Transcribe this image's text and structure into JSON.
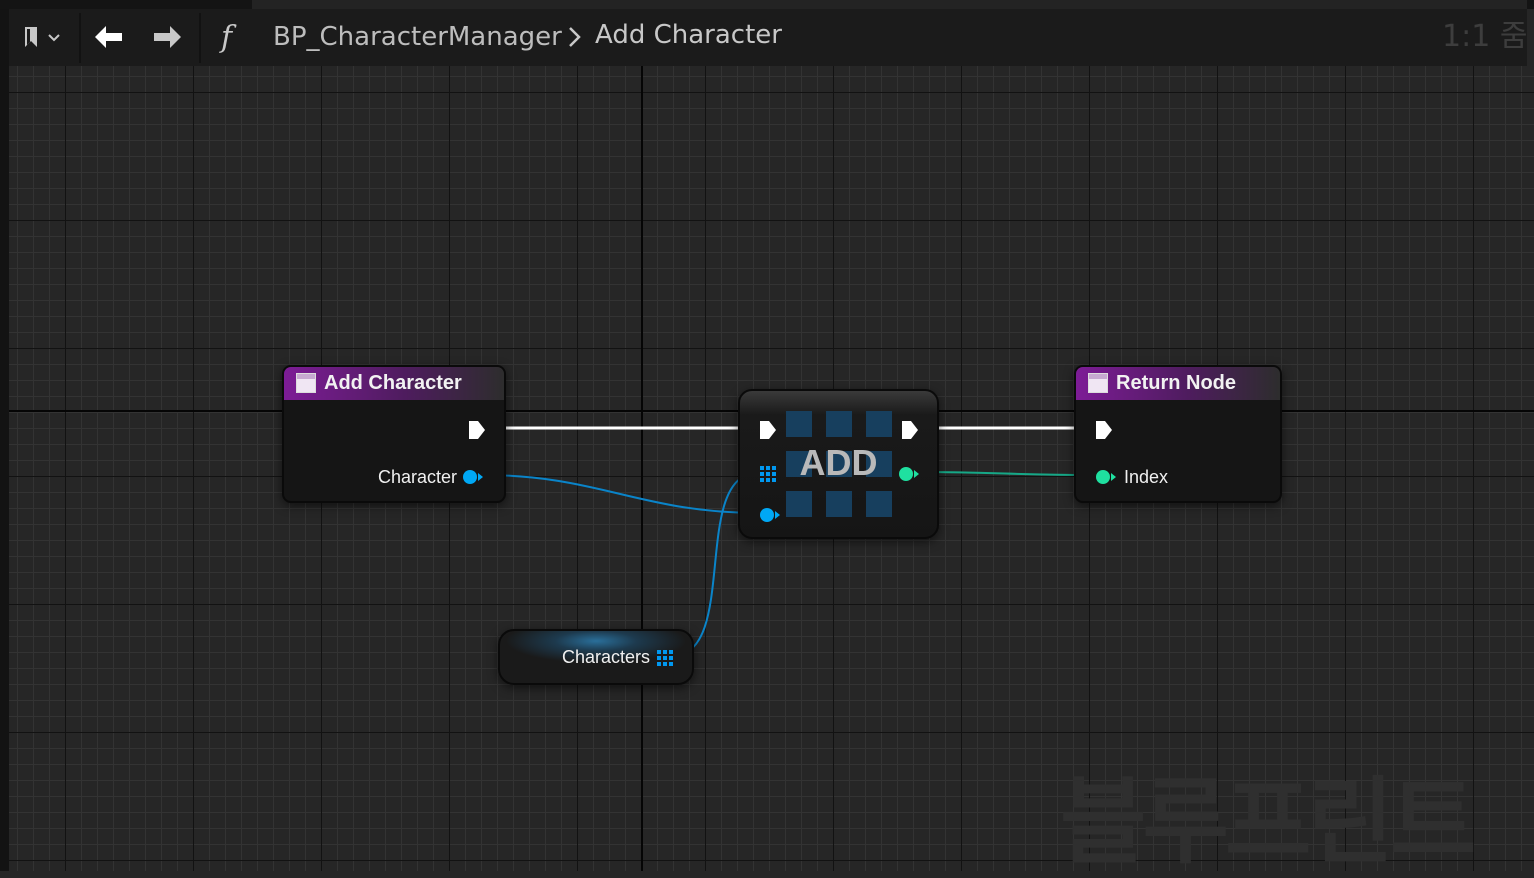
{
  "toolbar": {
    "bookmark_icon": "bookmark-icon",
    "back_icon": "arrow-left-icon",
    "forward_icon": "arrow-right-icon",
    "function_icon": "f",
    "breadcrumb": {
      "parent": "BP_CharacterManager",
      "current": "Add Character"
    },
    "zoom": "1:1 줌"
  },
  "graph": {
    "nodes": {
      "entry": {
        "title": "Add Character",
        "output_pin": "Character"
      },
      "add": {
        "title": "ADD"
      },
      "return": {
        "title": "Return Node",
        "input_pin": "Index"
      },
      "variable": {
        "label": "Characters"
      }
    },
    "watermark": "블루프린트"
  },
  "colors": {
    "function_header": "#7d1c96",
    "exec_wire": "#ffffff",
    "object_pin": "#00a8f5",
    "integer_pin": "#1fe0a0",
    "array_pin": "#0098f0"
  }
}
